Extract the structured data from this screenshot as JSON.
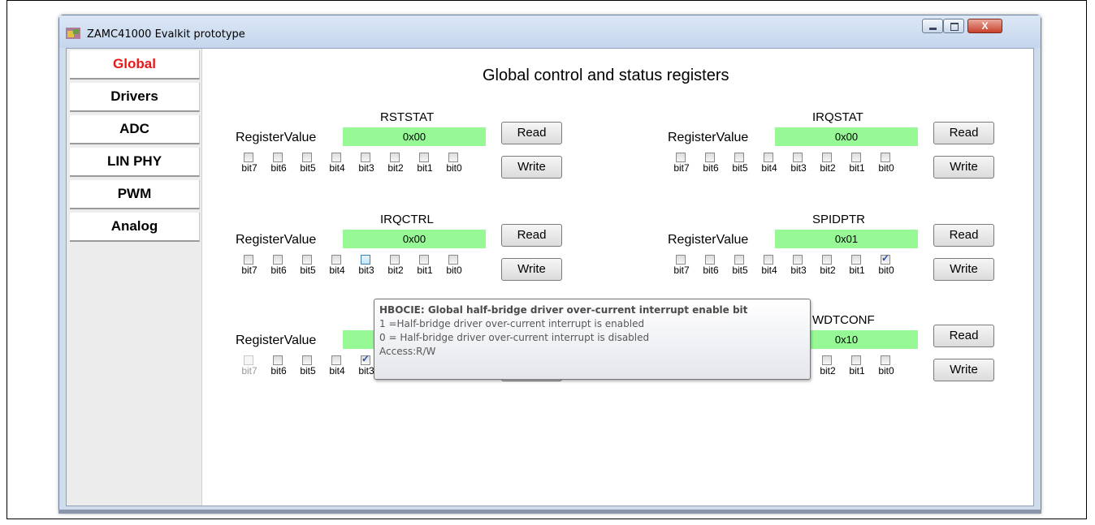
{
  "window": {
    "title": "ZAMC41000 Evalkit prototype",
    "close_symbol": "X"
  },
  "sidebar": {
    "items": [
      {
        "label": "Global",
        "active": true
      },
      {
        "label": "Drivers"
      },
      {
        "label": "ADC"
      },
      {
        "label": "LIN PHY"
      },
      {
        "label": "PWM"
      },
      {
        "label": "Analog"
      }
    ]
  },
  "main": {
    "title": "Global control and status registers",
    "register_value_label": "RegisterValue",
    "read_label": "Read",
    "write_label": "Write",
    "bit_labels": [
      "bit7",
      "bit6",
      "bit5",
      "bit4",
      "bit3",
      "bit2",
      "bit1",
      "bit0"
    ],
    "registers": [
      {
        "name": "RSTSTAT",
        "value": "0x00",
        "checked": [],
        "disabled": []
      },
      {
        "name": "IRQSTAT",
        "value": "0x00",
        "checked": [],
        "disabled": []
      },
      {
        "name": "IRQCTRL",
        "value": "0x00",
        "checked": [],
        "disabled": [],
        "hover": [
          "bit3"
        ]
      },
      {
        "name": "SPIDPTR",
        "value": "0x01",
        "checked": [
          "bit0"
        ],
        "disabled": []
      },
      {
        "name": "",
        "value": "",
        "checked": [
          "bit3",
          "bit2"
        ],
        "disabled": [
          "bit7"
        ]
      },
      {
        "name": "WDTCONF",
        "value": "0x10",
        "checked": [
          "bit4"
        ],
        "disabled": []
      }
    ]
  },
  "tooltip": {
    "title": "HBOCIE: Global half-bridge driver over-current interrupt enable bit",
    "line1": "1 =Half-bridge driver over-current interrupt is enabled",
    "line2": "0 = Half-bridge driver over-current interrupt is disabled",
    "line3": "Access:R/W"
  },
  "colors": {
    "active_tab": "#e81818",
    "register_value_bg": "#96f996"
  }
}
